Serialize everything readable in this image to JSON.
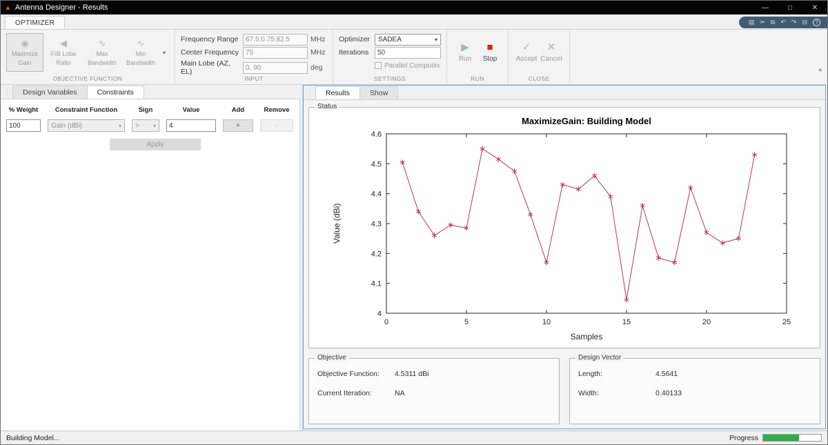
{
  "titlebar": {
    "title": "Antenna Designer - Results"
  },
  "icons": {
    "app": "▲",
    "minimize": "—",
    "maximize": "□",
    "close": "✕",
    "save": "▤",
    "cut": "✂",
    "copy": "⧉",
    "undo": "↶",
    "redo": "↷",
    "help": "?",
    "print": "⊟",
    "dropdown": "▾",
    "grip": "⋮",
    "collapse": "▴",
    "run": "▶",
    "stop": "■",
    "accept": "✓",
    "cancel": "✕",
    "maximize_gain": "◉",
    "fb_lobe_ratio": "◀",
    "max_bandwidth": "∿",
    "min_bandwidth": "∿",
    "plus": "+",
    "minus": "-"
  },
  "ribbon": {
    "tab_label": "OPTIMIZER"
  },
  "toolbar": {
    "objective": {
      "section_label": "OBJECTIVE FUNCTION",
      "buttons": [
        {
          "line1": "Maximize",
          "line2": "Gain"
        },
        {
          "line1": "F/B Lobe",
          "line2": "Ratio"
        },
        {
          "line1": "Max",
          "line2": "Bandwidth"
        },
        {
          "line1": "Min",
          "line2": "Bandwidth"
        }
      ]
    },
    "input": {
      "section_label": "INPUT",
      "rows": [
        {
          "label": "Frequency Range",
          "value": "67.5:0.75:82.5",
          "unit": "MHz"
        },
        {
          "label": "Center Frequency",
          "value": "75",
          "unit": "MHz"
        },
        {
          "label": "Main Lobe (AZ, EL)",
          "value": "0, 90",
          "unit": "deg"
        }
      ]
    },
    "settings": {
      "section_label": "SETTINGS",
      "optimizer_label": "Optimizer",
      "optimizer_value": "SADEA",
      "iterations_label": "Iterations",
      "iterations_value": "50",
      "parallel_label": "Parallel Computing"
    },
    "run": {
      "section_label": "RUN",
      "run_label": "Run",
      "stop_label": "Stop"
    },
    "close": {
      "section_label": "CLOSE",
      "accept_label": "Accept",
      "cancel_label": "Cancel"
    }
  },
  "left_panel": {
    "tabs": [
      {
        "label": "Design Variables"
      },
      {
        "label": "Constraints"
      }
    ],
    "table": {
      "headers": [
        "% Weight",
        "Constraint Function",
        "Sign",
        "Value",
        "Add",
        "Remove"
      ],
      "row": {
        "weight": "100",
        "function": "Gain (dBi)",
        "sign": ">",
        "value": "4"
      }
    },
    "apply_label": "Apply"
  },
  "right_panel": {
    "tabs": [
      {
        "label": "Results"
      },
      {
        "label": "Show"
      }
    ],
    "status_group_label": "Status",
    "objective_group": {
      "label": "Objective",
      "rows": [
        {
          "label": "Objective Function:",
          "value": "4.5311 dBi"
        },
        {
          "label": "Current Iteration:",
          "value": "NA"
        }
      ]
    },
    "design_group": {
      "label": "Design Vector",
      "rows": [
        {
          "label": "Length:",
          "value": "4.5641"
        },
        {
          "label": "Width:",
          "value": "0.40133"
        }
      ]
    }
  },
  "statusbar": {
    "text": "Building Model...",
    "progress_label": "Progress",
    "progress_percent": 62
  },
  "chart_data": {
    "type": "line",
    "title": "MaximizeGain: Building Model",
    "xlabel": "Samples",
    "ylabel": "Value (dBi)",
    "xlim": [
      0,
      25
    ],
    "ylim": [
      4,
      4.6
    ],
    "xticks": [
      0,
      5,
      10,
      15,
      20,
      25
    ],
    "yticks": [
      4,
      4.1,
      4.2,
      4.3,
      4.4,
      4.5,
      4.6
    ],
    "marker": "asterisk",
    "line_color": "#b23a52",
    "legend": null,
    "grid": false,
    "x": [
      1,
      2,
      3,
      4,
      5,
      6,
      7,
      8,
      9,
      10,
      11,
      12,
      13,
      14,
      15,
      16,
      17,
      18,
      19,
      20,
      21,
      22,
      23
    ],
    "y": [
      4.505,
      4.34,
      4.26,
      4.295,
      4.285,
      4.55,
      4.515,
      4.475,
      4.33,
      4.17,
      4.43,
      4.415,
      4.46,
      4.39,
      4.045,
      4.36,
      4.185,
      4.17,
      4.42,
      4.27,
      4.235,
      4.25,
      4.53
    ]
  }
}
